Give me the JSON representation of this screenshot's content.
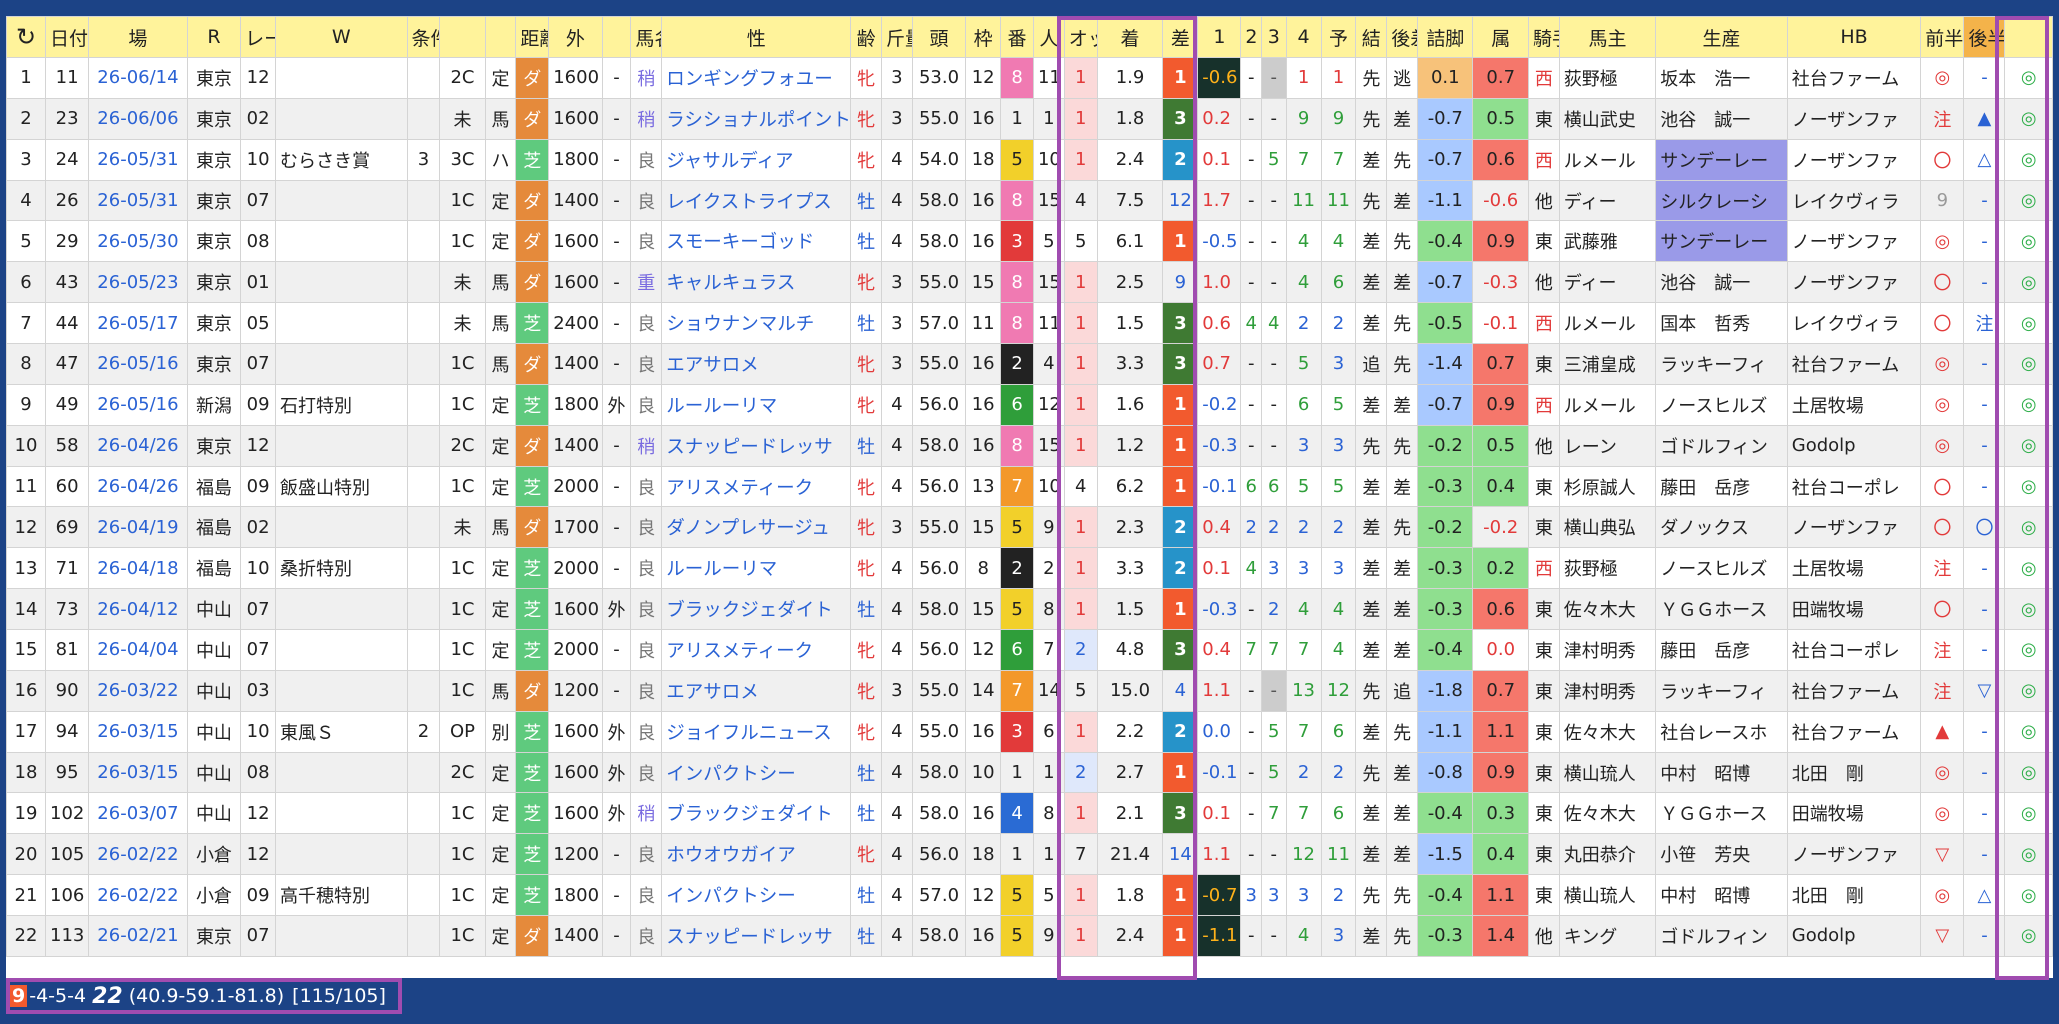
{
  "headers": [
    "",
    "日付",
    "場",
    "R",
    "レース名",
    "W",
    "条件",
    "",
    "",
    "距離",
    "外",
    "",
    "馬名",
    "性",
    "齢",
    "斤量",
    "頭",
    "枠",
    "番",
    "人",
    "オッズ",
    "着",
    "差",
    "1",
    "2",
    "3",
    "4",
    "予",
    "結",
    "後差",
    "詰脚",
    "属",
    "騎手",
    "馬主",
    "生産",
    "HB",
    "前半",
    "後半",
    ""
  ],
  "rows": [
    [
      "1",
      "11",
      "26-06/14",
      "東京",
      "12",
      "",
      "",
      "2C",
      "定",
      "ダ",
      "1600",
      "-",
      "稍",
      "ロンギングフォユー",
      "牝",
      "3",
      "53.0",
      "12",
      "8",
      "11",
      "1",
      "1.9",
      "1",
      "-0.6",
      "-",
      "-",
      "1",
      "1",
      "先",
      "逃",
      "0.1",
      "0.7",
      "西",
      "荻野極",
      "坂本　浩一",
      "社台ファーム",
      "◎",
      "-",
      "◎"
    ],
    [
      "2",
      "23",
      "26-06/06",
      "東京",
      "02",
      "",
      "",
      "未",
      "馬",
      "ダ",
      "1600",
      "-",
      "稍",
      "ラシショナルポイント",
      "牝",
      "3",
      "55.0",
      "16",
      "1",
      "1",
      "1",
      "1.8",
      "3",
      "0.2",
      "-",
      "-",
      "9",
      "9",
      "先",
      "差",
      "-0.7",
      "0.5",
      "東",
      "横山武史",
      "池谷　誠一",
      "ノーザンファ",
      "注",
      "▲",
      "◎"
    ],
    [
      "3",
      "24",
      "26-05/31",
      "東京",
      "10",
      "むらさき賞",
      "3",
      "3C",
      "ハ",
      "芝",
      "1800",
      "-",
      "良",
      "ジャサルディア",
      "牝",
      "4",
      "54.0",
      "18",
      "5",
      "10",
      "1",
      "2.4",
      "2",
      "0.1",
      "-",
      "5",
      "7",
      "7",
      "差",
      "先",
      "-0.7",
      "0.6",
      "西",
      "ルメール",
      "サンデーレー",
      "ノーザンファ",
      "〇",
      "△",
      "◎"
    ],
    [
      "4",
      "26",
      "26-05/31",
      "東京",
      "07",
      "",
      "",
      "1C",
      "定",
      "ダ",
      "1400",
      "-",
      "良",
      "レイクストライプス",
      "牡",
      "4",
      "58.0",
      "16",
      "8",
      "15",
      "4",
      "7.5",
      "12",
      "1.7",
      "-",
      "-",
      "11",
      "11",
      "先",
      "差",
      "-1.1",
      "-0.6",
      "他",
      "ディー",
      "シルクレーシ",
      "レイクヴィラ",
      "9",
      "-",
      "◎"
    ],
    [
      "5",
      "29",
      "26-05/30",
      "東京",
      "08",
      "",
      "",
      "1C",
      "定",
      "ダ",
      "1600",
      "-",
      "良",
      "スモーキーゴッド",
      "牡",
      "4",
      "58.0",
      "16",
      "3",
      "5",
      "5",
      "6.1",
      "1",
      "-0.5",
      "-",
      "-",
      "4",
      "4",
      "差",
      "先",
      "-0.4",
      "0.9",
      "東",
      "武藤雅",
      "サンデーレー",
      "ノーザンファ",
      "◎",
      "-",
      "◎"
    ],
    [
      "6",
      "43",
      "26-05/23",
      "東京",
      "01",
      "",
      "",
      "未",
      "馬",
      "ダ",
      "1600",
      "-",
      "重",
      "キャルキュラス",
      "牝",
      "3",
      "55.0",
      "15",
      "8",
      "15",
      "1",
      "2.5",
      "9",
      "1.0",
      "-",
      "-",
      "4",
      "6",
      "差",
      "差",
      "-0.7",
      "-0.3",
      "他",
      "ディー",
      "池谷　誠一",
      "ノーザンファ",
      "〇",
      "-",
      "◎"
    ],
    [
      "7",
      "44",
      "26-05/17",
      "東京",
      "05",
      "",
      "",
      "未",
      "馬",
      "芝",
      "2400",
      "-",
      "良",
      "ショウナンマルチ",
      "牡",
      "3",
      "57.0",
      "11",
      "8",
      "11",
      "1",
      "1.5",
      "3",
      "0.6",
      "4",
      "4",
      "2",
      "2",
      "差",
      "先",
      "-0.5",
      "-0.1",
      "西",
      "ルメール",
      "国本　哲秀",
      "レイクヴィラ",
      "〇",
      "注",
      "◎"
    ],
    [
      "8",
      "47",
      "26-05/16",
      "東京",
      "07",
      "",
      "",
      "1C",
      "馬",
      "ダ",
      "1400",
      "-",
      "良",
      "エアサロメ",
      "牝",
      "3",
      "55.0",
      "16",
      "2",
      "4",
      "1",
      "3.3",
      "3",
      "0.7",
      "-",
      "-",
      "5",
      "3",
      "追",
      "先",
      "-1.4",
      "0.7",
      "東",
      "三浦皇成",
      "ラッキーフィ",
      "社台ファーム",
      "◎",
      "-",
      "◎"
    ],
    [
      "9",
      "49",
      "26-05/16",
      "新潟",
      "09",
      "石打特別",
      "",
      "1C",
      "定",
      "芝",
      "1800",
      "外",
      "良",
      "ルールーリマ",
      "牝",
      "4",
      "56.0",
      "16",
      "6",
      "12",
      "1",
      "1.6",
      "1",
      "-0.2",
      "-",
      "-",
      "6",
      "5",
      "差",
      "差",
      "-0.7",
      "0.9",
      "西",
      "ルメール",
      "ノースヒルズ",
      "土居牧場",
      "◎",
      "-",
      "◎"
    ],
    [
      "10",
      "58",
      "26-04/26",
      "東京",
      "12",
      "",
      "",
      "2C",
      "定",
      "ダ",
      "1400",
      "-",
      "稍",
      "スナッピードレッサ",
      "牡",
      "4",
      "58.0",
      "16",
      "8",
      "15",
      "1",
      "1.2",
      "1",
      "-0.3",
      "-",
      "-",
      "3",
      "3",
      "先",
      "先",
      "-0.2",
      "0.5",
      "他",
      "レーン",
      "ゴドルフィン",
      "Godolp",
      "◎",
      "-",
      "◎"
    ],
    [
      "11",
      "60",
      "26-04/26",
      "福島",
      "09",
      "飯盛山特別",
      "",
      "1C",
      "定",
      "芝",
      "2000",
      "-",
      "良",
      "アリスメティーク",
      "牝",
      "4",
      "56.0",
      "13",
      "7",
      "10",
      "4",
      "6.2",
      "1",
      "-0.1",
      "6",
      "6",
      "5",
      "5",
      "差",
      "差",
      "-0.3",
      "0.4",
      "東",
      "杉原誠人",
      "藤田　岳彦",
      "社台コーポレ",
      "〇",
      "-",
      "◎"
    ],
    [
      "12",
      "69",
      "26-04/19",
      "福島",
      "02",
      "",
      "",
      "未",
      "馬",
      "ダ",
      "1700",
      "-",
      "良",
      "ダノンプレサージュ",
      "牝",
      "3",
      "55.0",
      "15",
      "5",
      "9",
      "1",
      "2.3",
      "2",
      "0.4",
      "2",
      "2",
      "2",
      "2",
      "差",
      "先",
      "-0.2",
      "-0.2",
      "東",
      "横山典弘",
      "ダノックス",
      "ノーザンファ",
      "〇",
      "〇",
      "◎"
    ],
    [
      "13",
      "71",
      "26-04/18",
      "福島",
      "10",
      "桑折特別",
      "",
      "1C",
      "定",
      "芝",
      "2000",
      "-",
      "良",
      "ルールーリマ",
      "牝",
      "4",
      "56.0",
      "8",
      "2",
      "2",
      "1",
      "3.3",
      "2",
      "0.1",
      "4",
      "3",
      "3",
      "3",
      "差",
      "差",
      "-0.3",
      "0.2",
      "西",
      "荻野極",
      "ノースヒルズ",
      "土居牧場",
      "注",
      "-",
      "◎"
    ],
    [
      "14",
      "73",
      "26-04/12",
      "中山",
      "07",
      "",
      "",
      "1C",
      "定",
      "芝",
      "1600",
      "外",
      "良",
      "ブラックジェダイト",
      "牡",
      "4",
      "58.0",
      "15",
      "5",
      "8",
      "1",
      "1.5",
      "1",
      "-0.3",
      "-",
      "2",
      "4",
      "4",
      "差",
      "差",
      "-0.3",
      "0.6",
      "東",
      "佐々木大",
      "ＹＧＧホース",
      "田端牧場",
      "〇",
      "-",
      "◎"
    ],
    [
      "15",
      "81",
      "26-04/04",
      "中山",
      "07",
      "",
      "",
      "1C",
      "定",
      "芝",
      "2000",
      "-",
      "良",
      "アリスメティーク",
      "牝",
      "4",
      "56.0",
      "12",
      "6",
      "7",
      "2",
      "4.8",
      "3",
      "0.4",
      "7",
      "7",
      "7",
      "4",
      "差",
      "差",
      "-0.4",
      "0.0",
      "東",
      "津村明秀",
      "藤田　岳彦",
      "社台コーポレ",
      "注",
      "-",
      "◎"
    ],
    [
      "16",
      "90",
      "26-03/22",
      "中山",
      "03",
      "",
      "",
      "1C",
      "馬",
      "ダ",
      "1200",
      "-",
      "良",
      "エアサロメ",
      "牝",
      "3",
      "55.0",
      "14",
      "7",
      "14",
      "5",
      "15.0",
      "4",
      "1.1",
      "-",
      "-",
      "13",
      "12",
      "先",
      "追",
      "-1.8",
      "0.7",
      "東",
      "津村明秀",
      "ラッキーフィ",
      "社台ファーム",
      "注",
      "▽",
      "◎"
    ],
    [
      "17",
      "94",
      "26-03/15",
      "中山",
      "10",
      "東風Ｓ",
      "2",
      "OP",
      "別",
      "芝",
      "1600",
      "外",
      "良",
      "ジョイフルニュース",
      "牝",
      "4",
      "55.0",
      "16",
      "3",
      "6",
      "1",
      "2.2",
      "2",
      "0.0",
      "-",
      "5",
      "7",
      "6",
      "差",
      "先",
      "-1.1",
      "1.1",
      "東",
      "佐々木大",
      "社台レースホ",
      "社台ファーム",
      "▲",
      "-",
      "◎"
    ],
    [
      "18",
      "95",
      "26-03/15",
      "中山",
      "08",
      "",
      "",
      "2C",
      "定",
      "芝",
      "1600",
      "外",
      "良",
      "インパクトシー",
      "牡",
      "4",
      "58.0",
      "10",
      "1",
      "1",
      "2",
      "2.7",
      "1",
      "-0.1",
      "-",
      "5",
      "2",
      "2",
      "先",
      "差",
      "-0.8",
      "0.9",
      "東",
      "横山琉人",
      "中村　昭博",
      "北田　剛",
      "◎",
      "-",
      "◎"
    ],
    [
      "19",
      "102",
      "26-03/07",
      "中山",
      "12",
      "",
      "",
      "1C",
      "定",
      "芝",
      "1600",
      "外",
      "稍",
      "ブラックジェダイト",
      "牡",
      "4",
      "58.0",
      "16",
      "4",
      "8",
      "1",
      "2.1",
      "3",
      "0.1",
      "-",
      "7",
      "7",
      "6",
      "差",
      "差",
      "-0.4",
      "0.3",
      "東",
      "佐々木大",
      "ＹＧＧホース",
      "田端牧場",
      "◎",
      "-",
      "◎"
    ],
    [
      "20",
      "105",
      "26-02/22",
      "小倉",
      "12",
      "",
      "",
      "1C",
      "定",
      "芝",
      "1200",
      "-",
      "良",
      "ホウオウガイア",
      "牝",
      "4",
      "56.0",
      "18",
      "1",
      "1",
      "7",
      "21.4",
      "14",
      "1.1",
      "-",
      "-",
      "12",
      "11",
      "差",
      "差",
      "-1.5",
      "0.4",
      "東",
      "丸田恭介",
      "小笹　芳央",
      "ノーザンファ",
      "▽",
      "-",
      "◎"
    ],
    [
      "21",
      "106",
      "26-02/22",
      "小倉",
      "09",
      "高千穂特別",
      "",
      "1C",
      "定",
      "芝",
      "1800",
      "-",
      "良",
      "インパクトシー",
      "牡",
      "4",
      "57.0",
      "12",
      "5",
      "5",
      "1",
      "1.8",
      "1",
      "-0.7",
      "3",
      "3",
      "3",
      "2",
      "先",
      "先",
      "-0.4",
      "1.1",
      "東",
      "横山琉人",
      "中村　昭博",
      "北田　剛",
      "◎",
      "△",
      "◎"
    ],
    [
      "22",
      "113",
      "26-02/21",
      "東京",
      "07",
      "",
      "",
      "1C",
      "定",
      "ダ",
      "1400",
      "-",
      "良",
      "スナッピードレッサ",
      "牡",
      "4",
      "58.0",
      "16",
      "5",
      "9",
      "1",
      "2.4",
      "1",
      "-1.1",
      "-",
      "-",
      "4",
      "3",
      "差",
      "先",
      "-0.3",
      "1.4",
      "他",
      "キング",
      "ゴドルフィン",
      "Godolp",
      "▽",
      "-",
      "◎"
    ]
  ],
  "status": {
    "count": "9",
    "record": "-4-5-4",
    "total": "22",
    "rates": "(40.9-59.1-81.8)",
    "ratio": "[115/105]"
  }
}
